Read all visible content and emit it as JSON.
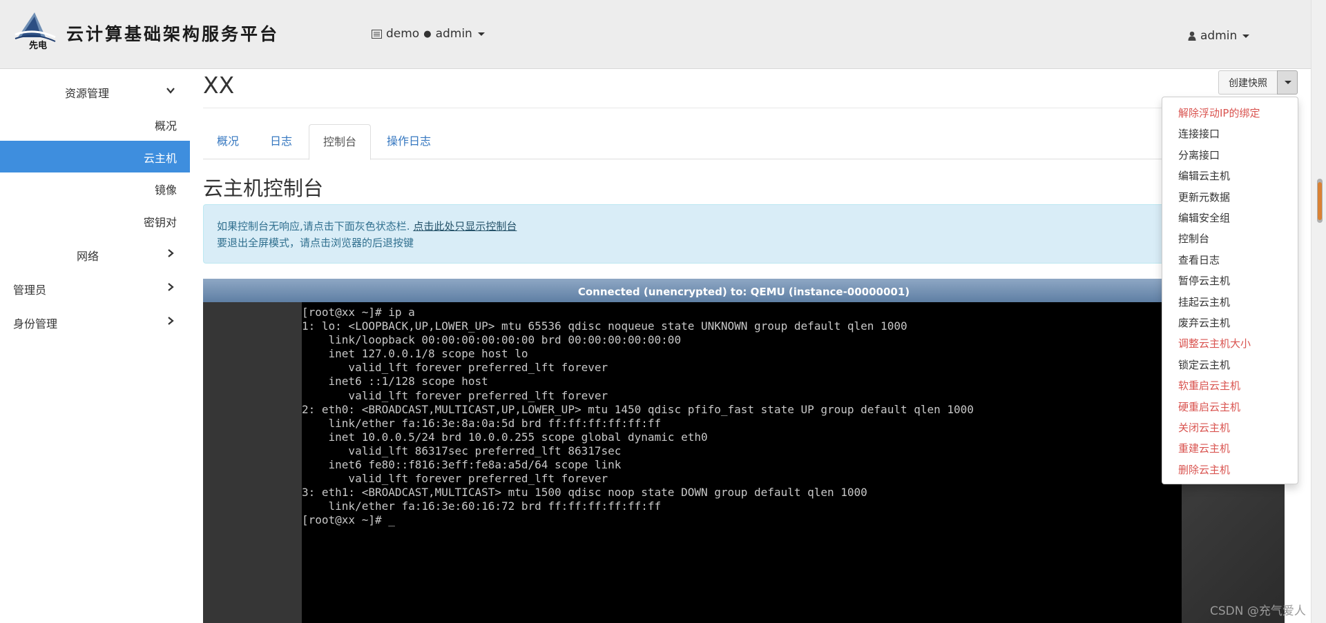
{
  "header": {
    "brand_title": "云计算基础架构服务平台",
    "logo_text": "先电",
    "project_menu": {
      "project": "demo",
      "separator": "●",
      "user": "admin"
    },
    "user_menu": {
      "label": "admin"
    }
  },
  "sidebar": {
    "groups": [
      {
        "label": "资源管理",
        "expanded": true,
        "items": [
          {
            "label": "概况",
            "active": false
          },
          {
            "label": "云主机",
            "active": true
          },
          {
            "label": "镜像",
            "active": false
          },
          {
            "label": "密钥对",
            "active": false
          }
        ]
      },
      {
        "label": "网络",
        "expanded": false
      },
      {
        "label": "管理员",
        "expanded": false
      },
      {
        "label": "身份管理",
        "expanded": false
      }
    ]
  },
  "main": {
    "instance_name": "XX",
    "tabs": [
      {
        "label": "概况",
        "active": false
      },
      {
        "label": "日志",
        "active": false
      },
      {
        "label": "控制台",
        "active": true
      },
      {
        "label": "操作日志",
        "active": false
      }
    ],
    "section_title": "云主机控制台",
    "alert": {
      "line1_text": "如果控制台无响应,请点击下面灰色状态栏. ",
      "line1_link": "点击此处只显示控制台",
      "line2_text": "要退出全屏模式，请点击浏览器的后退按键"
    },
    "console": {
      "status": "Connected (unencrypted) to: QEMU (instance-00000001)",
      "lines": [
        "[root@xx ~]# ip a",
        "1: lo: <LOOPBACK,UP,LOWER_UP> mtu 65536 qdisc noqueue state UNKNOWN group default qlen 1000",
        "    link/loopback 00:00:00:00:00:00 brd 00:00:00:00:00:00",
        "    inet 127.0.0.1/8 scope host lo",
        "       valid_lft forever preferred_lft forever",
        "    inet6 ::1/128 scope host",
        "       valid_lft forever preferred_lft forever",
        "2: eth0: <BROADCAST,MULTICAST,UP,LOWER_UP> mtu 1450 qdisc pfifo_fast state UP group default qlen 1000",
        "    link/ether fa:16:3e:8a:0a:5d brd ff:ff:ff:ff:ff:ff",
        "    inet 10.0.0.5/24 brd 10.0.0.255 scope global dynamic eth0",
        "       valid_lft 86317sec preferred_lft 86317sec",
        "    inet6 fe80::f816:3eff:fe8a:a5d/64 scope link",
        "       valid_lft forever preferred_lft forever",
        "3: eth1: <BROADCAST,MULTICAST> mtu 1500 qdisc noop state DOWN group default qlen 1000",
        "    link/ether fa:16:3e:60:16:72 brd ff:ff:ff:ff:ff:ff",
        "[root@xx ~]# _"
      ]
    }
  },
  "actions": {
    "primary_label": "创建快照",
    "menu": [
      {
        "label": "解除浮动IP的绑定",
        "danger": true
      },
      {
        "label": "连接接口",
        "danger": false
      },
      {
        "label": "分离接口",
        "danger": false
      },
      {
        "label": "编辑云主机",
        "danger": false
      },
      {
        "label": "更新元数据",
        "danger": false
      },
      {
        "label": "编辑安全组",
        "danger": false
      },
      {
        "label": "控制台",
        "danger": false
      },
      {
        "label": "查看日志",
        "danger": false
      },
      {
        "label": "暂停云主机",
        "danger": false
      },
      {
        "label": "挂起云主机",
        "danger": false
      },
      {
        "label": "废弃云主机",
        "danger": false
      },
      {
        "label": "调整云主机大小",
        "danger": true
      },
      {
        "label": "锁定云主机",
        "danger": false
      },
      {
        "label": "软重启云主机",
        "danger": true
      },
      {
        "label": "硬重启云主机",
        "danger": true
      },
      {
        "label": "关闭云主机",
        "danger": true
      },
      {
        "label": "重建云主机",
        "danger": true
      },
      {
        "label": "删除云主机",
        "danger": true
      }
    ]
  },
  "watermark": "CSDN @充气爱人",
  "colors": {
    "accent": "#3e8ede",
    "danger": "#d9534f",
    "link": "#3577c0",
    "alert_bg": "#d9edf7"
  }
}
